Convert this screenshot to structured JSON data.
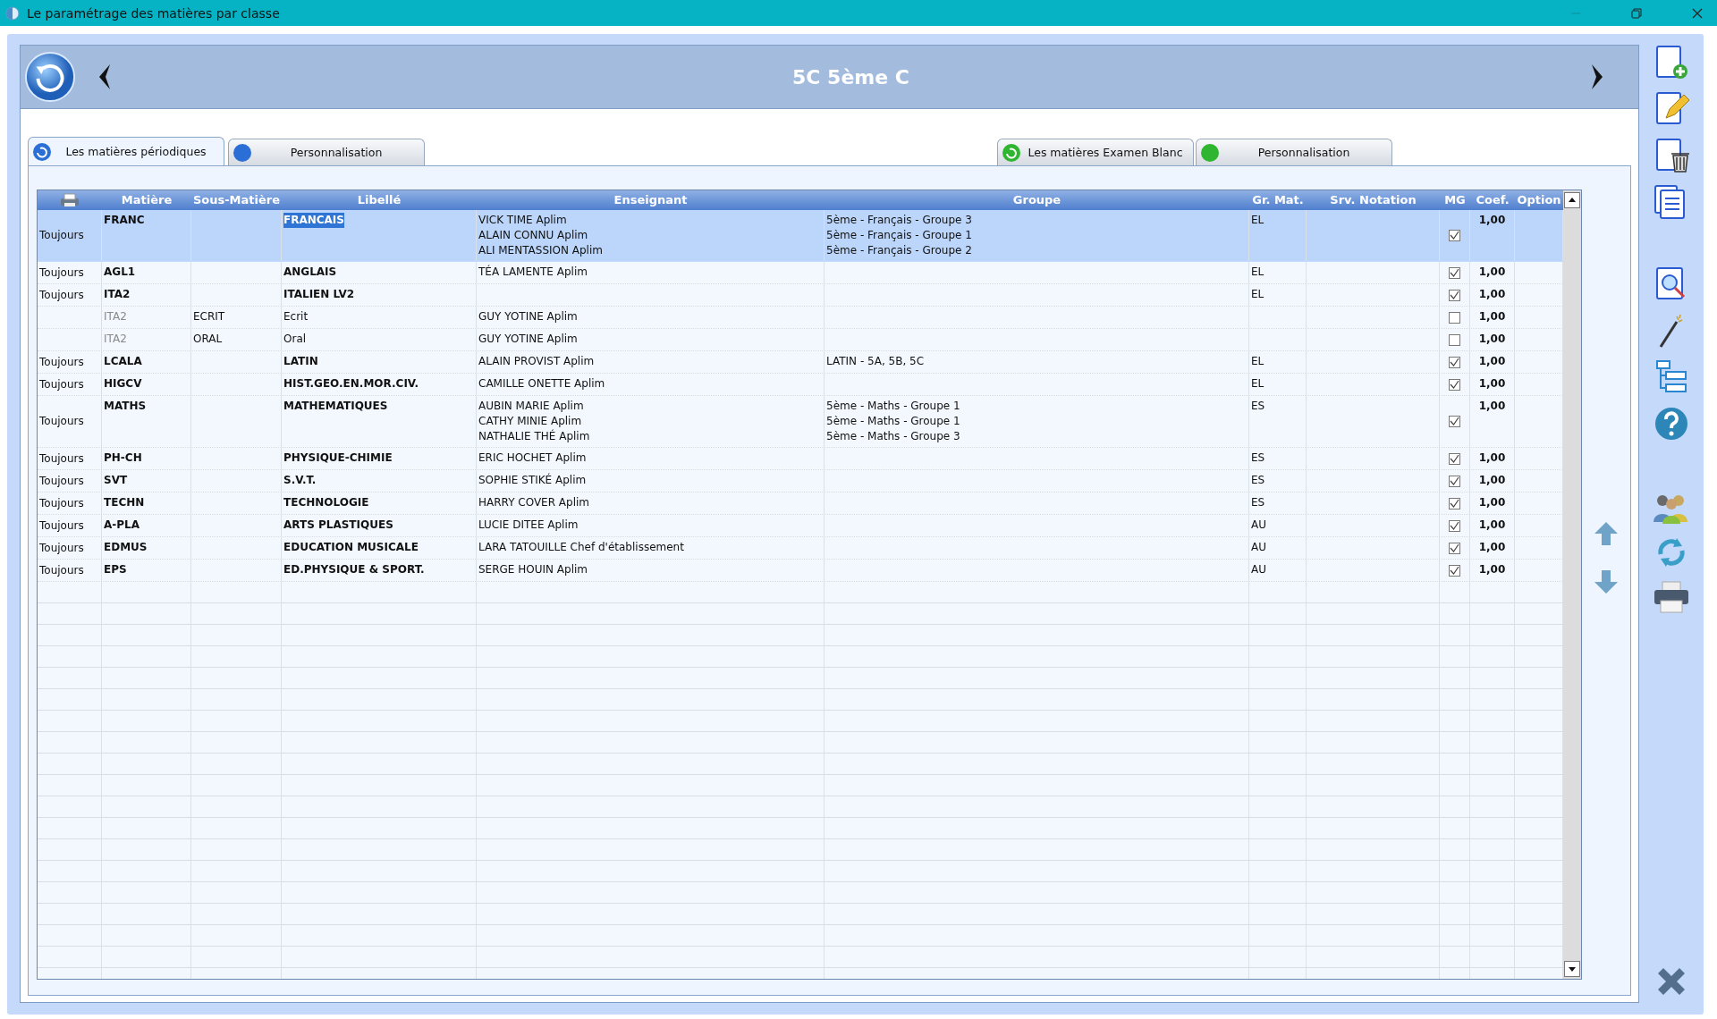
{
  "window": {
    "title": "Le paramétrage des matières par classe"
  },
  "header": {
    "title": "5C 5ème C"
  },
  "tabs_left": [
    {
      "label": "Les matières périodiques",
      "selected": true
    },
    {
      "label": "Personnalisation",
      "selected": false
    }
  ],
  "tabs_right": [
    {
      "label": "Les matières Examen Blanc",
      "selected": false
    },
    {
      "label": "Personnalisation",
      "selected": false
    }
  ],
  "table": {
    "columns": [
      "Matière",
      "Sous-Matière",
      "Libellé",
      "Enseignant",
      "Groupe",
      "Gr. Mat.",
      "Srv. Notation",
      "MG",
      "Coef.",
      "Option"
    ],
    "rows": [
      {
        "kind": "main",
        "selected": true,
        "column_1": "Toujours",
        "matiere": "FRANC",
        "libelle": "FRANCAIS",
        "enseignant": [
          "VICK TIME Aplim",
          "ALAIN CONNU Aplim",
          "ALI MENTASSION Aplim"
        ],
        "groupe": [
          "5ème - Français - Groupe 3",
          "5ème - Français - Groupe 1",
          "5ème - Français - Groupe 2"
        ],
        "gr_mat": "EL",
        "mg": true,
        "coef": "1,00"
      },
      {
        "kind": "main",
        "selected": false,
        "column_1": "Toujours",
        "matiere": "AGL1",
        "libelle": "ANGLAIS",
        "enseignant": [
          "TÉA LAMENTE Aplim"
        ],
        "gr_mat": "EL",
        "mg": true,
        "coef": "1,00"
      },
      {
        "kind": "main",
        "selected": false,
        "column_1": "Toujours",
        "matiere": "ITA2",
        "libelle": "ITALIEN LV2",
        "gr_mat": "EL",
        "mg": true,
        "coef": "1,00"
      },
      {
        "kind": "sub",
        "selected": false,
        "matiere": "ITA2",
        "sous_matiere": "ECRIT",
        "libelle": "Ecrit",
        "enseignant": [
          "GUY YOTINE Aplim"
        ],
        "mg": false,
        "coef": "1,00"
      },
      {
        "kind": "sub",
        "selected": false,
        "matiere": "ITA2",
        "sous_matiere": "ORAL",
        "libelle": "Oral",
        "enseignant": [
          "GUY YOTINE Aplim"
        ],
        "mg": false,
        "coef": "1,00"
      },
      {
        "kind": "main",
        "selected": false,
        "column_1": "Toujours",
        "matiere": "LCALA",
        "libelle": "LATIN",
        "enseignant": [
          "ALAIN PROVIST Aplim"
        ],
        "groupe": [
          "LATIN - 5A, 5B, 5C"
        ],
        "gr_mat": "EL",
        "mg": true,
        "coef": "1,00"
      },
      {
        "kind": "main",
        "selected": false,
        "column_1": "Toujours",
        "matiere": "HIGCV",
        "libelle": "HIST.GEO.EN.MOR.CIV.",
        "enseignant": [
          "CAMILLE ONETTE Aplim"
        ],
        "gr_mat": "EL",
        "mg": true,
        "coef": "1,00"
      },
      {
        "kind": "main",
        "selected": false,
        "column_1": "Toujours",
        "matiere": "MATHS",
        "libelle": "MATHEMATIQUES",
        "enseignant": [
          "AUBIN MARIE Aplim",
          "CATHY MINIE Aplim",
          "NATHALIE THÉ Aplim"
        ],
        "groupe": [
          "5ème - Maths - Groupe 1",
          "5ème - Maths - Groupe 1",
          "5ème - Maths - Groupe 3"
        ],
        "gr_mat": "ES",
        "mg": true,
        "coef": "1,00"
      },
      {
        "kind": "main",
        "selected": false,
        "column_1": "Toujours",
        "matiere": "PH-CH",
        "libelle": "PHYSIQUE-CHIMIE",
        "enseignant": [
          "ERIC HOCHET Aplim"
        ],
        "gr_mat": "ES",
        "mg": true,
        "coef": "1,00"
      },
      {
        "kind": "main",
        "selected": false,
        "column_1": "Toujours",
        "matiere": "SVT",
        "libelle": "S.V.T.",
        "enseignant": [
          "SOPHIE STIKÉ Aplim"
        ],
        "gr_mat": "ES",
        "mg": true,
        "coef": "1,00"
      },
      {
        "kind": "main",
        "selected": false,
        "column_1": "Toujours",
        "matiere": "TECHN",
        "libelle": "TECHNOLOGIE",
        "enseignant": [
          "HARRY COVER Aplim"
        ],
        "gr_mat": "ES",
        "mg": true,
        "coef": "1,00"
      },
      {
        "kind": "main",
        "selected": false,
        "column_1": "Toujours",
        "matiere": "A-PLA",
        "libelle": "ARTS PLASTIQUES",
        "enseignant": [
          "LUCIE DITEE Aplim"
        ],
        "gr_mat": "AU",
        "mg": true,
        "coef": "1,00"
      },
      {
        "kind": "main",
        "selected": false,
        "column_1": "Toujours",
        "matiere": "EDMUS",
        "libelle": "EDUCATION MUSICALE",
        "enseignant": [
          "LARA TATOUILLE Chef d'établissement"
        ],
        "gr_mat": "AU",
        "mg": true,
        "coef": "1,00"
      },
      {
        "kind": "main",
        "selected": false,
        "column_1": "Toujours",
        "matiere": "EPS",
        "libelle": "ED.PHYSIQUE & SPORT.",
        "enseignant": [
          "SERGE HOUIN Aplim"
        ],
        "gr_mat": "AU",
        "mg": true,
        "coef": "1,00"
      }
    ]
  }
}
